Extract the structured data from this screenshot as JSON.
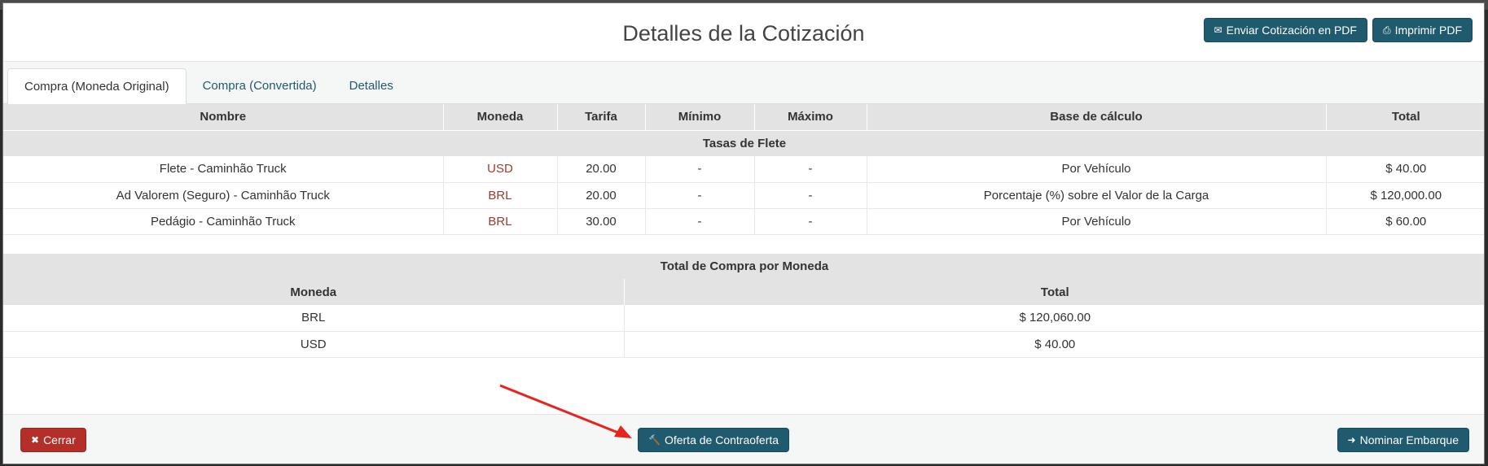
{
  "modal": {
    "title": "Detalles de la Cotización",
    "send_pdf_label": "Enviar Cotización en PDF",
    "print_pdf_label": "Imprimir PDF"
  },
  "tabs": [
    {
      "label": "Compra (Moneda Original)",
      "active": true
    },
    {
      "label": "Compra (Convertida)",
      "active": false
    },
    {
      "label": "Detalles",
      "active": false
    }
  ],
  "rates_table": {
    "headers": [
      "Nombre",
      "Moneda",
      "Tarifa",
      "Mínimo",
      "Máximo",
      "Base de cálculo",
      "Total"
    ],
    "section_title": "Tasas de Flete",
    "rows": [
      [
        "Flete - Caminhão Truck",
        "USD",
        "20.00",
        "-",
        "-",
        "Por Vehículo",
        "$ 40.00"
      ],
      [
        "Ad Valorem (Seguro) - Caminhão Truck",
        "BRL",
        "20.00",
        "-",
        "-",
        "Porcentaje (%) sobre el Valor de la Carga",
        "$ 120,000.00"
      ],
      [
        "Pedágio - Caminhão Truck",
        "BRL",
        "30.00",
        "-",
        "-",
        "Por Vehículo",
        "$ 60.00"
      ]
    ]
  },
  "totals_table": {
    "title": "Total de Compra por Moneda",
    "headers": [
      "Moneda",
      "Total"
    ],
    "rows": [
      [
        "BRL",
        "$ 120,060.00"
      ],
      [
        "USD",
        "$ 40.00"
      ]
    ]
  },
  "footer": {
    "close_label": "Cerrar",
    "counter_offer_label": "Oferta de Contraoferta",
    "nominate_label": "Nominar Embarque"
  },
  "colors": {
    "primary": "#1f5a6e",
    "danger": "#b52f2a",
    "currency_text": "#9b3a34",
    "annotation_arrow": "#e8231f"
  },
  "icons": {
    "send_pdf": "envelope-icon",
    "print_pdf": "print-icon",
    "close": "times-icon",
    "counter_offer": "gavel-icon",
    "nominate": "arrow-right-icon"
  }
}
